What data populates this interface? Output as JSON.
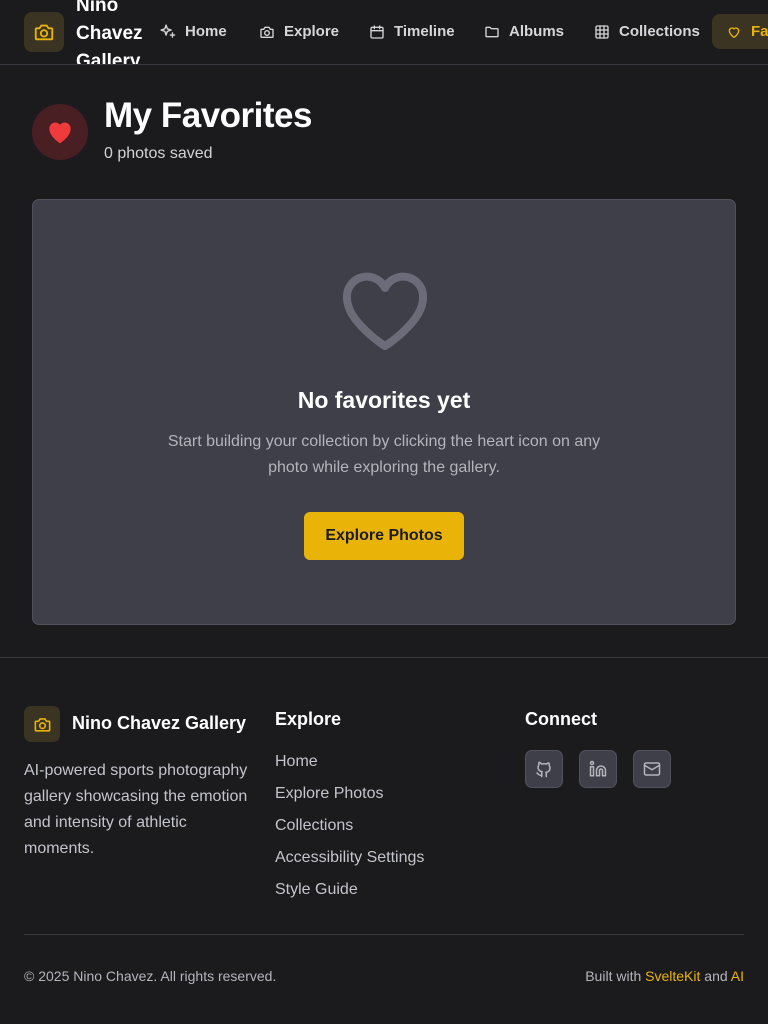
{
  "header": {
    "brand": "Nino Chavez Gallery",
    "nav": [
      {
        "label": "Home",
        "icon": "sparkles-icon"
      },
      {
        "label": "Explore",
        "icon": "camera-icon"
      },
      {
        "label": "Timeline",
        "icon": "calendar-icon"
      },
      {
        "label": "Albums",
        "icon": "folder-icon"
      },
      {
        "label": "Collections",
        "icon": "grid-icon"
      },
      {
        "label": "Favorites",
        "icon": "heart-icon",
        "active": true
      }
    ]
  },
  "page": {
    "title": "My Favorites",
    "subtitle": "0 photos saved"
  },
  "empty_state": {
    "title": "No favorites yet",
    "description": "Start building your collection by clicking the heart icon on any photo while exploring the gallery.",
    "button_label": "Explore Photos"
  },
  "footer": {
    "brand": "Nino Chavez Gallery",
    "description": "AI-powered sports photography gallery showcasing the emotion and intensity of athletic moments.",
    "explore_title": "Explore",
    "explore_links": [
      "Home",
      "Explore Photos",
      "Collections",
      "Accessibility Settings",
      "Style Guide"
    ],
    "connect_title": "Connect",
    "social": [
      "github-icon",
      "linkedin-icon",
      "mail-icon"
    ],
    "copyright": "© 2025 Nino Chavez. All rights reserved.",
    "built_prefix": "Built with",
    "built_link1": "SvelteKit",
    "built_and": "and",
    "built_link2": "AI"
  },
  "colors": {
    "background": "#1b1b1e",
    "accent": "#eab308",
    "card": "#3f3f4a",
    "favorite_red": "#ef3b3b"
  }
}
